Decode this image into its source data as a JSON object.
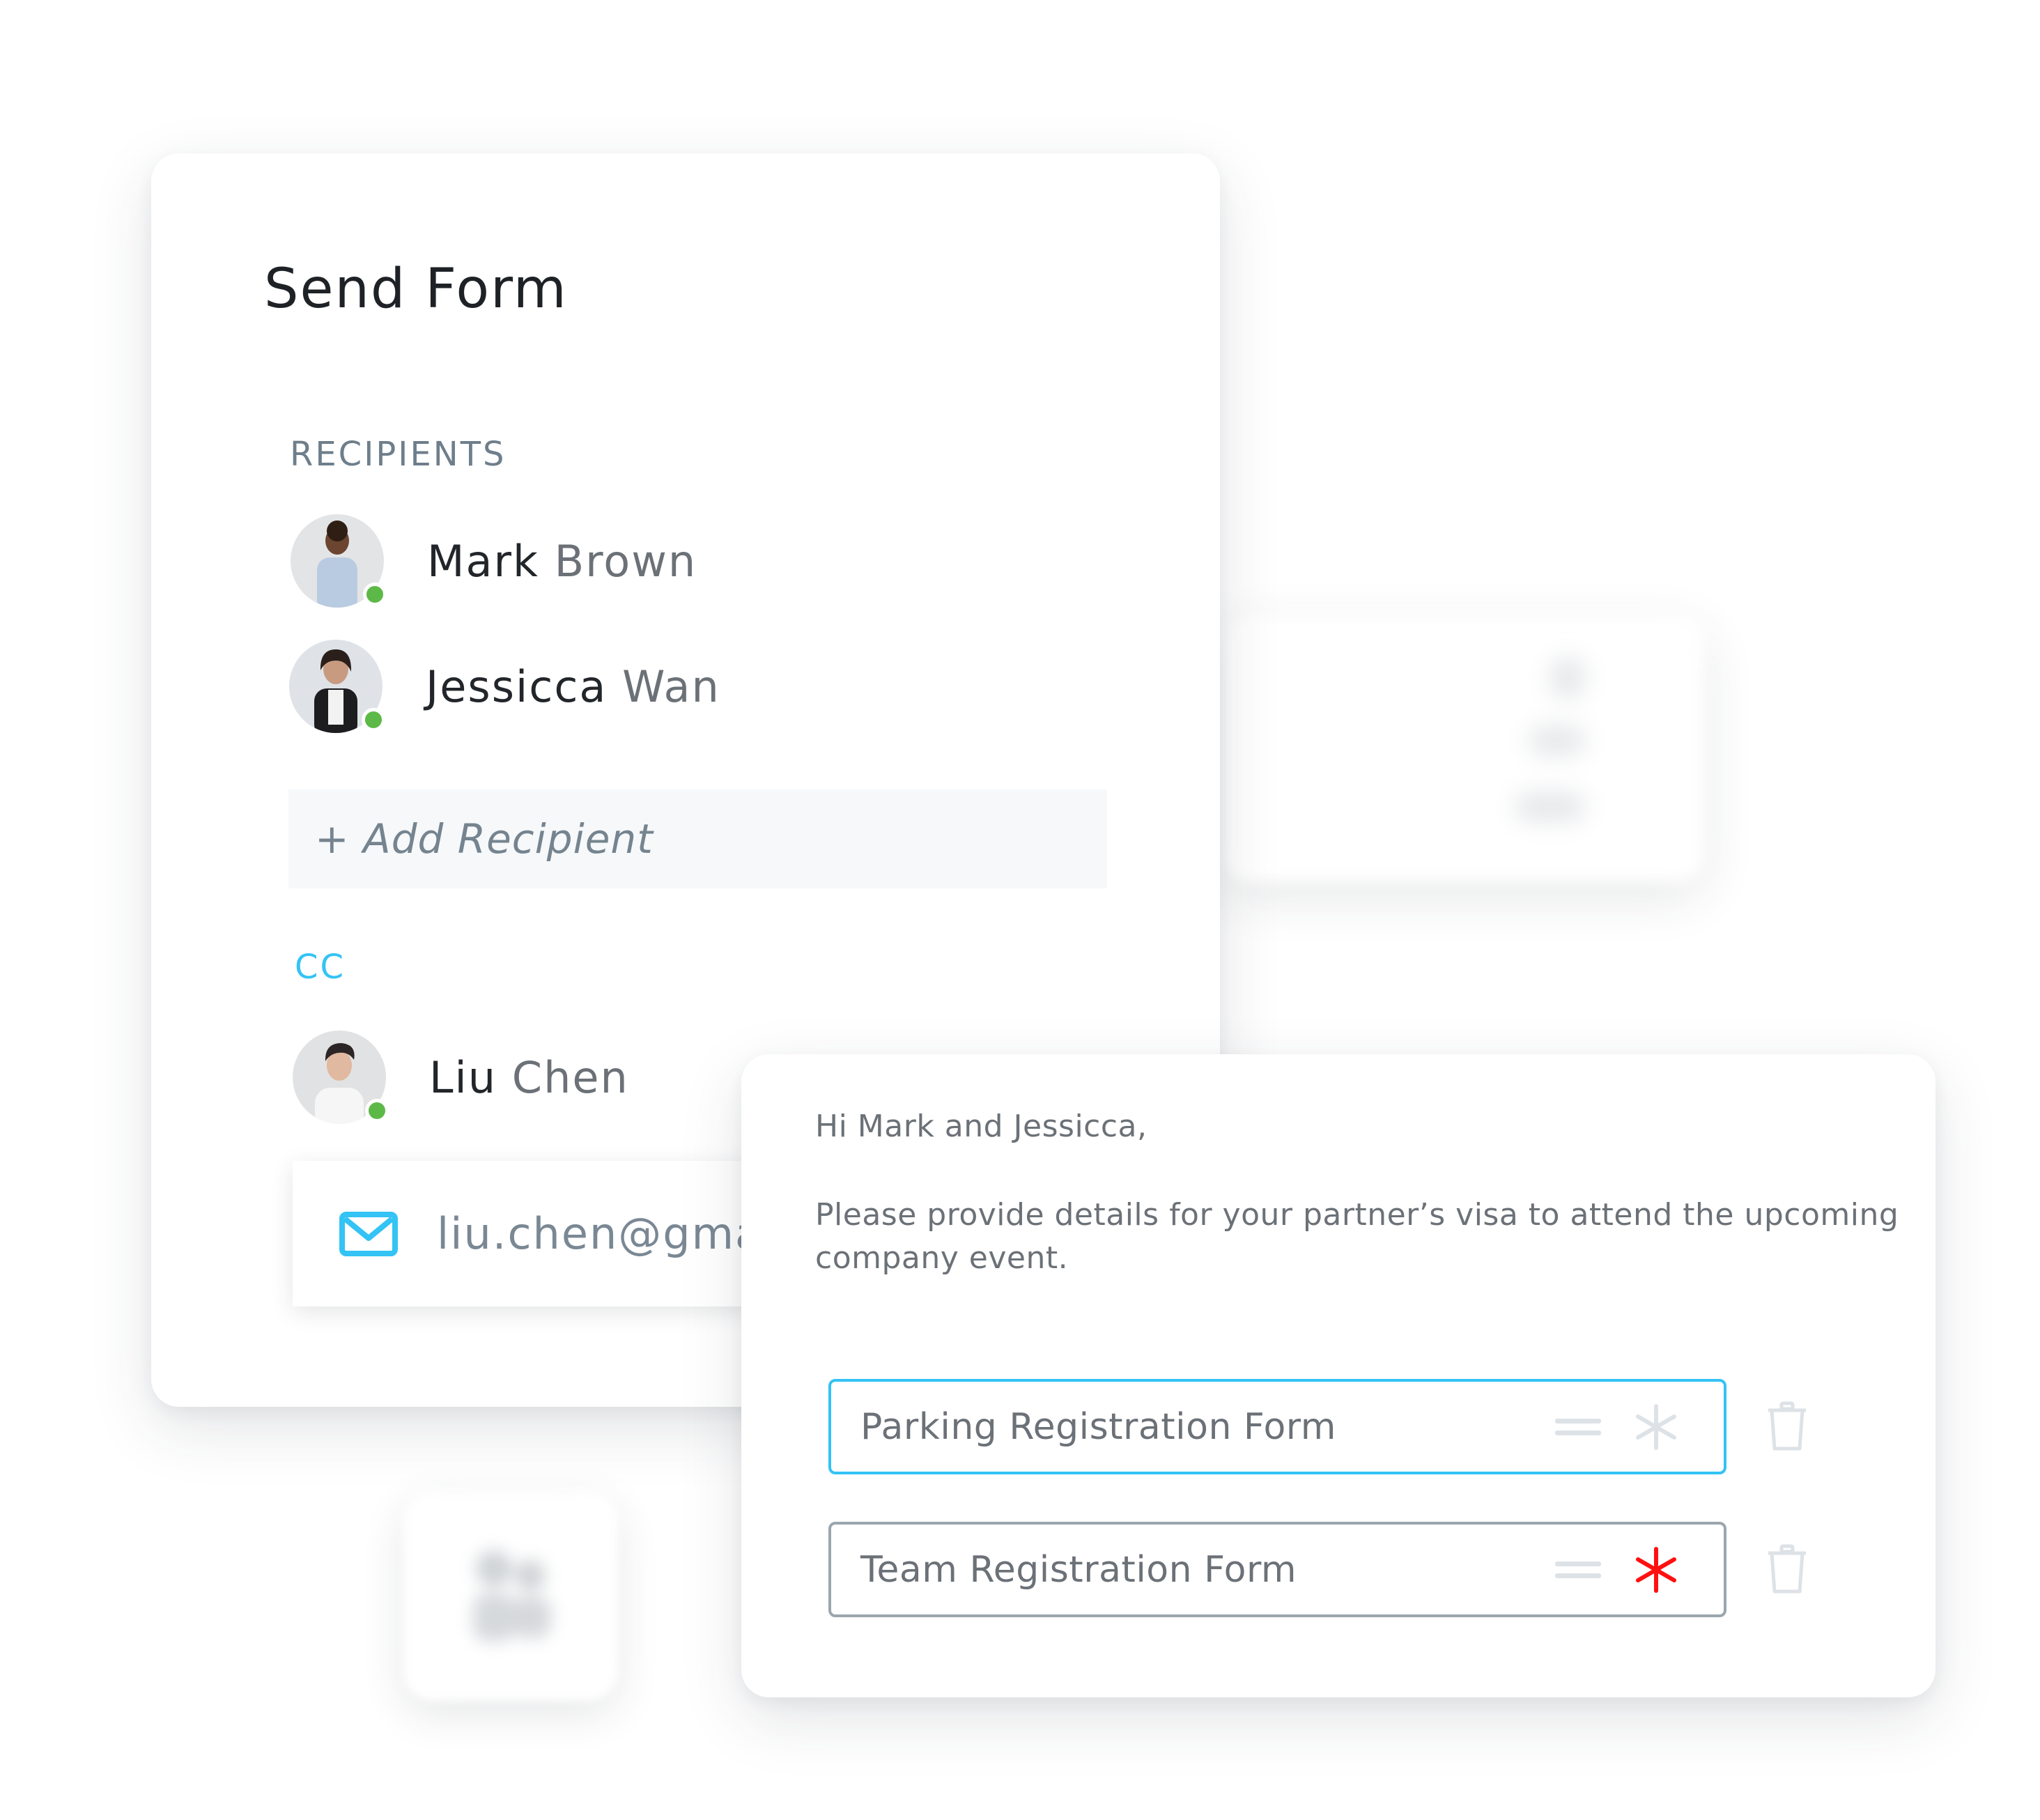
{
  "send_form": {
    "title": "Send Form",
    "recipients_label": "RECIPIENTS",
    "recipients": [
      {
        "first": "Mark",
        "last": "Brown",
        "status": "online"
      },
      {
        "first": "Jessicca",
        "last": "Wan",
        "status": "online"
      }
    ],
    "add_recipient_label": "+ Add Recipient",
    "cc_label": "CC",
    "cc": [
      {
        "first": "Liu",
        "last": "Chen",
        "status": "online"
      }
    ],
    "cc_email": "liu.chen@gma",
    "colors": {
      "accent": "#33c3f5",
      "online": "#5cb947",
      "required": "#ff1010"
    }
  },
  "message": {
    "greeting": "Hi Mark and Jessicca,",
    "body": "Please provide details for your partner’s visa to attend the upcoming company event.",
    "forms": [
      {
        "name": "Parking Registration Form",
        "required": false,
        "focused": true
      },
      {
        "name": "Team Registration Form",
        "required": true,
        "focused": false
      }
    ]
  }
}
